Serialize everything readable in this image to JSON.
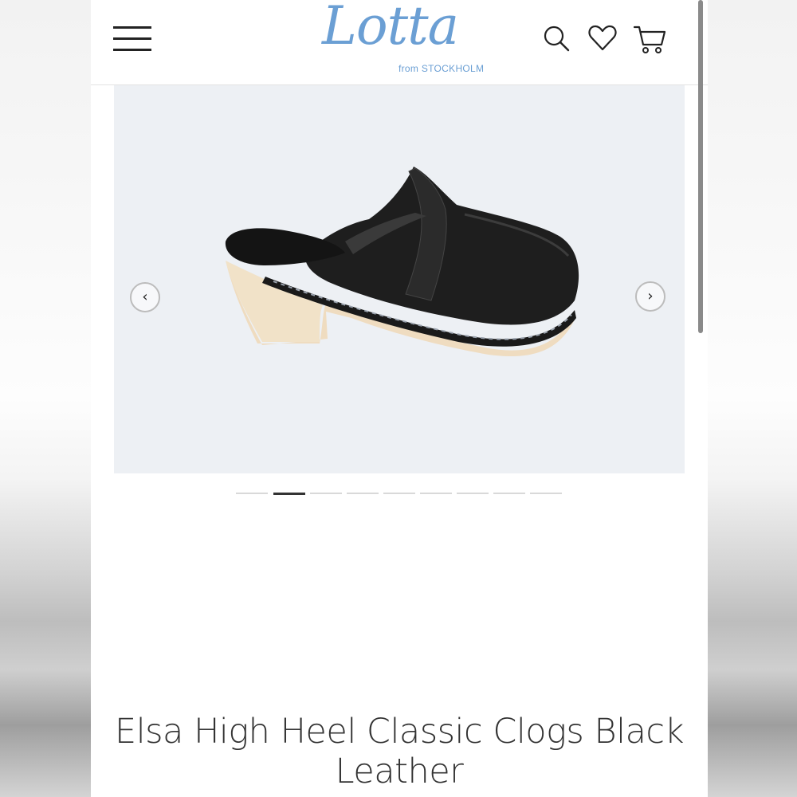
{
  "header": {
    "logo": {
      "script_text": "Lotta",
      "subtitle": "from STOCKHOLM",
      "color": "#6b9fd4"
    },
    "icons": {
      "menu": "hamburger-menu-icon",
      "search": "search-icon",
      "wishlist": "heart-icon",
      "cart": "cart-icon"
    }
  },
  "gallery": {
    "background": "#edf0f4",
    "prev_label": "‹",
    "next_label": "›",
    "slide_count": 9,
    "active_slide": 2,
    "image": "black-leather-high-heel-clog"
  },
  "product": {
    "title": "Elsa High Heel Classic Clogs Black Leather"
  }
}
